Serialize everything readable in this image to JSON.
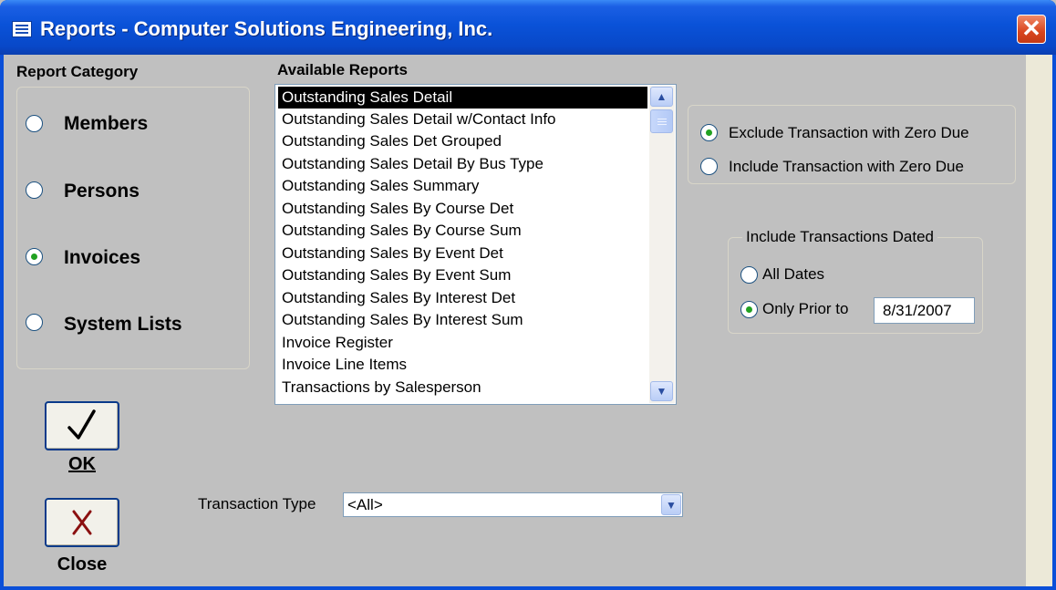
{
  "window": {
    "title": "Reports - Computer Solutions Engineering, Inc.",
    "close_glyph": "✕"
  },
  "category": {
    "heading": "Report Category",
    "options": [
      {
        "label": "Members",
        "checked": false
      },
      {
        "label": "Persons",
        "checked": false
      },
      {
        "label": "Invoices",
        "checked": true
      },
      {
        "label": "System Lists",
        "checked": false
      }
    ]
  },
  "reports": {
    "heading": "Available Reports",
    "items": [
      "Outstanding Sales Detail",
      "Outstanding Sales Detail w/Contact Info",
      "Outstanding Sales Det Grouped",
      "Outstanding Sales Detail By Bus Type",
      "Outstanding Sales Summary",
      "Outstanding Sales By Course Det",
      "Outstanding Sales By Course Sum",
      "Outstanding Sales By Event Det",
      "Outstanding Sales By Event Sum",
      "Outstanding Sales By Interest Det",
      "Outstanding Sales By Interest Sum",
      "Invoice Register",
      "Invoice Line Items",
      "Transactions by Salesperson"
    ],
    "selected_index": 0
  },
  "zero_due": {
    "options": [
      {
        "label": "Exclude Transaction with Zero Due",
        "checked": true
      },
      {
        "label": "Include Transaction with Zero Due",
        "checked": false
      }
    ]
  },
  "dated": {
    "legend": "Include Transactions Dated",
    "options": [
      {
        "label": "All Dates",
        "checked": false
      },
      {
        "label": "Only Prior to",
        "checked": true
      }
    ],
    "date_value": "8/31/2007"
  },
  "transaction_type": {
    "label": "Transaction Type",
    "value": "<All>"
  },
  "buttons": {
    "ok_label": "OK",
    "close_label": "Close"
  },
  "icons": {
    "ok": "checkmark-icon",
    "close": "x-icon",
    "title": "form-icon"
  }
}
